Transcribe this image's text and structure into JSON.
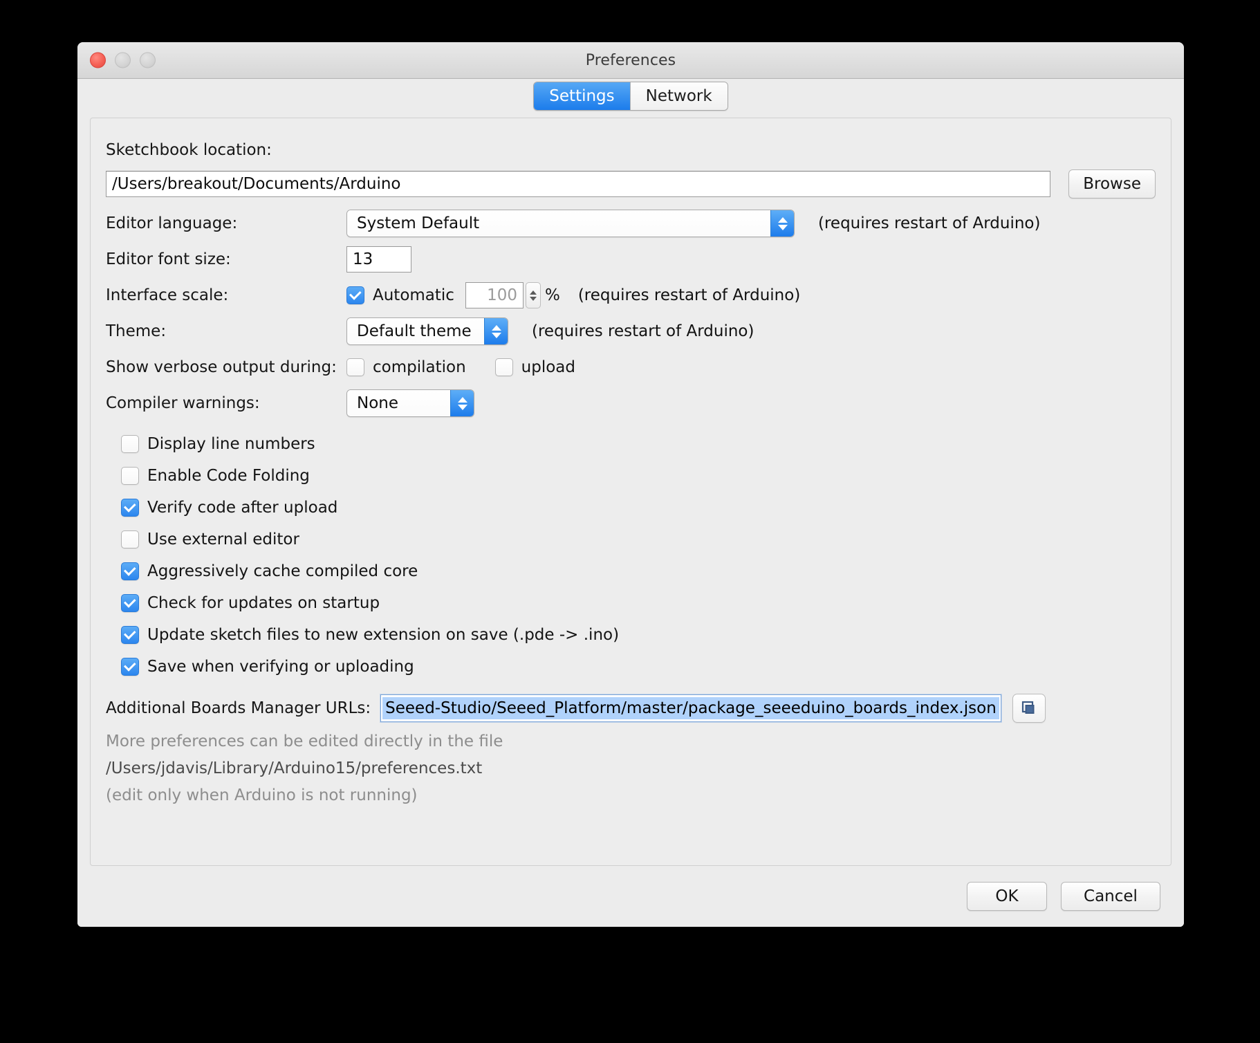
{
  "window": {
    "title": "Preferences",
    "traffic_lights": [
      "close",
      "minimize",
      "maximize"
    ]
  },
  "tabs": [
    {
      "label": "Settings",
      "active": true
    },
    {
      "label": "Network",
      "active": false
    }
  ],
  "settings": {
    "sketchbook": {
      "label": "Sketchbook location:",
      "value": "/Users/breakout/Documents/Arduino",
      "browse_label": "Browse"
    },
    "editor_language": {
      "label": "Editor language:",
      "value": "System Default",
      "note": "(requires restart of Arduino)"
    },
    "editor_font_size": {
      "label": "Editor font size:",
      "value": "13"
    },
    "interface_scale": {
      "label": "Interface scale:",
      "automatic_label": "Automatic",
      "automatic_checked": true,
      "value": "100",
      "percent": "%",
      "note": "(requires restart of Arduino)"
    },
    "theme": {
      "label": "Theme:",
      "value": "Default theme",
      "note": "(requires restart of Arduino)"
    },
    "verbose": {
      "label": "Show verbose output during:",
      "compilation_label": "compilation",
      "compilation_checked": false,
      "upload_label": "upload",
      "upload_checked": false
    },
    "compiler_warnings": {
      "label": "Compiler warnings:",
      "value": "None"
    },
    "checkboxes": [
      {
        "label": "Display line numbers",
        "checked": false
      },
      {
        "label": "Enable Code Folding",
        "checked": false
      },
      {
        "label": "Verify code after upload",
        "checked": true
      },
      {
        "label": "Use external editor",
        "checked": false
      },
      {
        "label": "Aggressively cache compiled core",
        "checked": true
      },
      {
        "label": "Check for updates on startup",
        "checked": true
      },
      {
        "label": "Update sketch files to new extension on save (.pde -> .ino)",
        "checked": true
      },
      {
        "label": "Save when verifying or uploading",
        "checked": true
      }
    ],
    "boards_urls": {
      "label": "Additional Boards Manager URLs:",
      "value": "Seeed-Studio/Seeed_Platform/master/package_seeeduino_boards_index.json",
      "selected": true
    },
    "help": {
      "line1": "More preferences can be edited directly in the file",
      "line2": "/Users/jdavis/Library/Arduino15/preferences.txt",
      "line3": "(edit only when Arduino is not running)"
    }
  },
  "buttons": {
    "ok": "OK",
    "cancel": "Cancel"
  },
  "colors": {
    "accent_blue": "#1d7ceb",
    "tab_active_blue": "#2b87ee",
    "selection_blue": "#b0d2fb",
    "window_bg": "#ececec",
    "panel_bg": "#ededed",
    "close_red": "#f56055"
  }
}
